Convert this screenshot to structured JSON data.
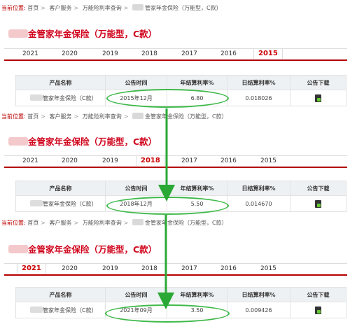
{
  "common": {
    "crumb_lead": "当前位置:",
    "crumb_home": "首页",
    "crumb_service": "客户服务",
    "crumb_query": "万能险利率查询",
    "crumb_product": "管家年金保险（万能型，C款）",
    "crumb_product_short": "金管家年金保险（万能型，C款）",
    "sep": ">",
    "title": "金管家年金保险（万能型，C款）",
    "years": [
      "2021",
      "2020",
      "2019",
      "2018",
      "2017",
      "2016",
      "2015"
    ],
    "headers": {
      "product": "产品名称",
      "time": "公告时间",
      "annual": "年结算利率%",
      "daily": "日结算利率%",
      "download": "公告下载"
    },
    "product_name": "管家年金保险（C款）"
  },
  "panels": [
    {
      "active_year": "2015",
      "time": "2015年12月",
      "annual": "6.80",
      "daily": "0.018026"
    },
    {
      "active_year": "2018",
      "time": "2018年12月",
      "annual": "5.50",
      "daily": "0.014670"
    },
    {
      "active_year": "2021",
      "time": "2021年09月",
      "annual": "3.50",
      "daily": "0.009426"
    }
  ],
  "colors": {
    "title_red": "#d0021b",
    "bar_red": "#b40000",
    "ellipse_green": "#3fb94a",
    "arrow_green": "#2aa836"
  }
}
